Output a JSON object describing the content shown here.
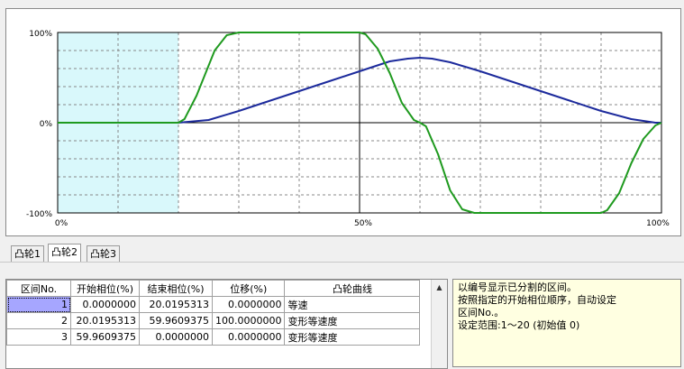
{
  "chart_data": {
    "type": "line",
    "y_ticks": [
      "100%",
      "0%",
      "-100%"
    ],
    "x_ticks": [
      "0%",
      "50%",
      "100%"
    ],
    "xlim": [
      0,
      100
    ],
    "ylim": [
      -100,
      100
    ],
    "grid": true,
    "highlight_x_range": [
      0,
      20
    ],
    "series": [
      {
        "color": "#1c2a9c",
        "x": [
          0,
          20,
          25,
          30,
          35,
          40,
          45,
          50,
          55,
          58,
          60,
          62,
          65,
          70,
          75,
          80,
          85,
          90,
          95,
          97,
          99,
          100
        ],
        "y": [
          0,
          0,
          3,
          13,
          24,
          35,
          46,
          57,
          68,
          71,
          72,
          71,
          67,
          57,
          46,
          35,
          24,
          13,
          4,
          2,
          0,
          0
        ]
      },
      {
        "color": "#1f9a1f",
        "x": [
          0,
          20,
          21,
          23,
          26,
          28,
          30,
          31,
          50,
          51,
          53,
          55,
          57,
          59,
          60,
          61,
          63,
          65,
          67,
          69,
          70,
          90,
          91,
          93,
          95,
          97,
          99,
          100
        ],
        "y": [
          0,
          0,
          4,
          30,
          80,
          97,
          100,
          100,
          100,
          98,
          82,
          55,
          22,
          3,
          0,
          -4,
          -35,
          -75,
          -96,
          -100,
          -100,
          -100,
          -97,
          -78,
          -45,
          -18,
          -3,
          0
        ]
      }
    ]
  },
  "tabs": [
    "凸轮1",
    "凸轮2",
    "凸轮3"
  ],
  "table": {
    "headers": [
      "区间No.",
      "开始相位(%)",
      "结束相位(%)",
      "位移(%)",
      "凸轮曲线"
    ],
    "rows": [
      [
        "1",
        "0.0000000",
        "20.0195313",
        "0.0000000",
        "等速"
      ],
      [
        "2",
        "20.0195313",
        "59.9609375",
        "100.0000000",
        "变形等速度"
      ],
      [
        "3",
        "59.9609375",
        "0.0000000",
        "0.0000000",
        "变形等速度"
      ]
    ]
  },
  "info": [
    "以编号显示已分割的区间。",
    "按照指定的开始相位顺序，自动设定",
    "区间No.。",
    "设定范围:1～20 (初始值 0)"
  ],
  "colors": {
    "highlight": "#d9f8fb",
    "selected": "#a6a6ff"
  }
}
